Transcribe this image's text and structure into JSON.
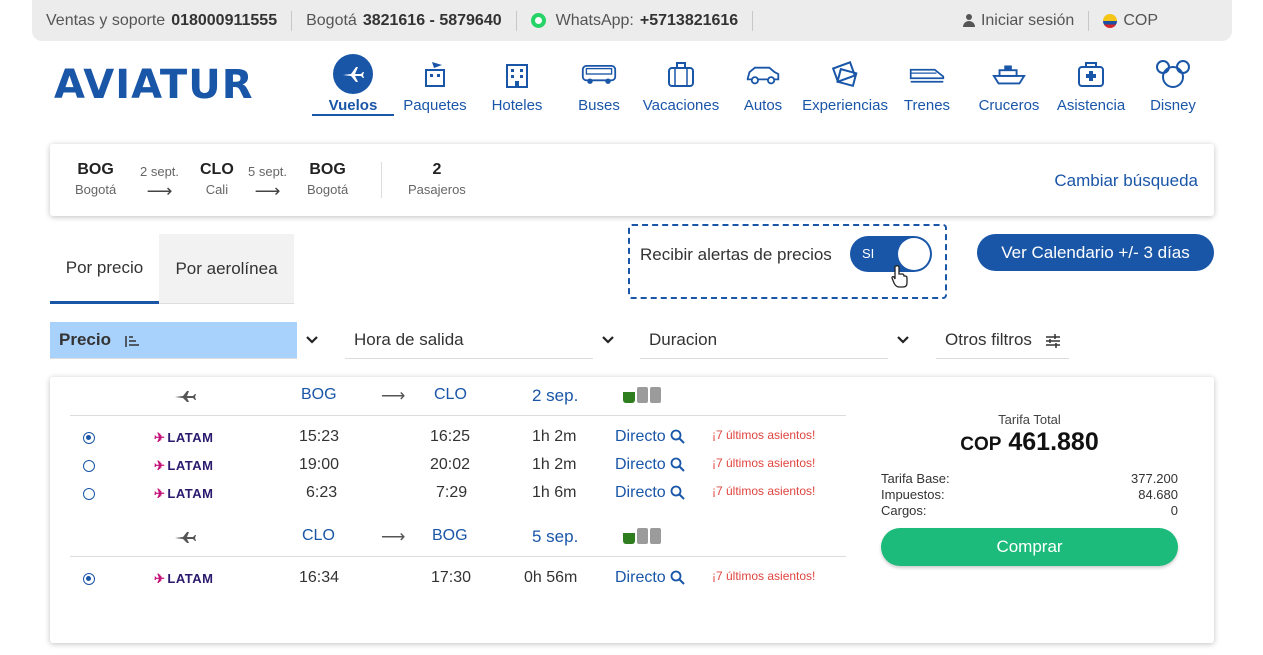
{
  "topbar": {
    "sales_label": "Ventas y soporte",
    "sales_phone": "018000911555",
    "city_label": "Bogotá",
    "city_phones": "3821616 - 5879640",
    "whatsapp_label": "WhatsApp:",
    "whatsapp_phone": "+5713821616",
    "login": "Iniciar sesión",
    "currency": "COP"
  },
  "logo": "AVIATUR",
  "nav": [
    {
      "label": "Vuelos",
      "icon": "airplane-icon",
      "active": true
    },
    {
      "label": "Paquetes",
      "icon": "package-icon"
    },
    {
      "label": "Hoteles",
      "icon": "hotel-icon"
    },
    {
      "label": "Buses",
      "icon": "bus-icon"
    },
    {
      "label": "Vacaciones",
      "icon": "suitcase-icon"
    },
    {
      "label": "Autos",
      "icon": "car-icon"
    },
    {
      "label": "Experiencias",
      "icon": "tickets-icon"
    },
    {
      "label": "Trenes",
      "icon": "train-icon"
    },
    {
      "label": "Cruceros",
      "icon": "ship-icon"
    },
    {
      "label": "Asistencia",
      "icon": "first-aid-icon"
    },
    {
      "label": "Disney",
      "icon": "mickey-icon"
    }
  ],
  "search": {
    "origin_code": "BOG",
    "origin_city": "Bogotá",
    "date_out": "2 sept.",
    "dest_code": "CLO",
    "dest_city": "Cali",
    "date_return": "5 sept.",
    "return_code": "BOG",
    "return_city": "Bogotá",
    "passengers_count": "2",
    "passengers_label": "Pasajeros",
    "change": "Cambiar búsqueda"
  },
  "tabs": {
    "by_price": "Por precio",
    "by_airline": "Por aerolínea"
  },
  "alerts": {
    "label": "Recibir alertas de precios",
    "toggle": "SI"
  },
  "calendar_button": "Ver Calendario +/- 3 días",
  "filters": {
    "price": "Precio",
    "departure": "Hora de salida",
    "duration": "Duracion",
    "others": "Otros filtros"
  },
  "results": {
    "outbound": {
      "from": "BOG",
      "to": "CLO",
      "date": "2 sep."
    },
    "outbound_flights": [
      {
        "airline": "LATAM",
        "dep": "15:23",
        "arr": "16:25",
        "dur": "1h 2m",
        "type": "Directo",
        "note": "¡7 últimos asientos!"
      },
      {
        "airline": "LATAM",
        "dep": "19:00",
        "arr": "20:02",
        "dur": "1h 2m",
        "type": "Directo",
        "note": "¡7 últimos asientos!"
      },
      {
        "airline": "LATAM",
        "dep": "6:23",
        "arr": "7:29",
        "dur": "1h 6m",
        "type": "Directo",
        "note": "¡7 últimos asientos!"
      }
    ],
    "return": {
      "from": "CLO",
      "to": "BOG",
      "date": "5 sep."
    },
    "return_flights": [
      {
        "airline": "LATAM",
        "dep": "16:34",
        "arr": "17:30",
        "dur": "0h 56m",
        "type": "Directo",
        "note": "¡7 últimos asientos!"
      }
    ],
    "total_label": "Tarifa Total",
    "currency": "COP",
    "total": "461.880",
    "base_label": "Tarifa Base:",
    "base": "377.200",
    "tax_label": "Impuestos:",
    "tax": "84.680",
    "fees_label": "Cargos:",
    "fees": "0",
    "buy": "Comprar"
  },
  "colors": {
    "brand": "#1a56a8",
    "buy": "#1dbb7b",
    "filter_active": "#a8d1fb",
    "warning": "#e0443e"
  }
}
